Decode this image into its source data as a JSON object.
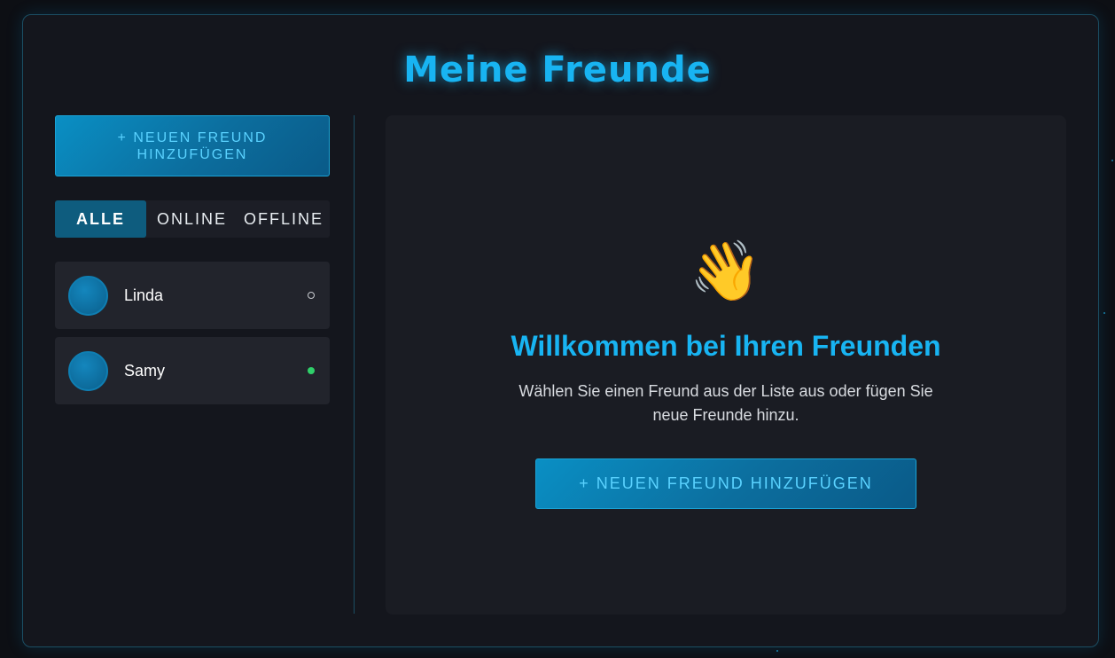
{
  "page": {
    "title": "Meine Freunde"
  },
  "sidebar": {
    "add_button_label": "+ NEUEN FREUND HINZUFÜGEN",
    "filters": [
      {
        "label": "ALLE",
        "active": true
      },
      {
        "label": "ONLINE",
        "active": false
      },
      {
        "label": "OFFLINE",
        "active": false
      }
    ],
    "friends": [
      {
        "name": "Linda",
        "status": "offline",
        "status_glyph": "○"
      },
      {
        "name": "Samy",
        "status": "online",
        "status_glyph": "●"
      }
    ]
  },
  "main": {
    "icon": "waving-hand-icon",
    "emoji": "👋",
    "title": "Willkommen bei Ihren Freunden",
    "text": "Wählen Sie einen Freund aus der Liste aus oder fügen Sie neue Freunde hinzu.",
    "add_button_label": "+ NEUEN FREUND HINZUFÜGEN"
  },
  "colors": {
    "accent": "#18b4f2",
    "button_bg": "#0c6e9e",
    "online": "#2fd06a",
    "background": "#14161d"
  }
}
